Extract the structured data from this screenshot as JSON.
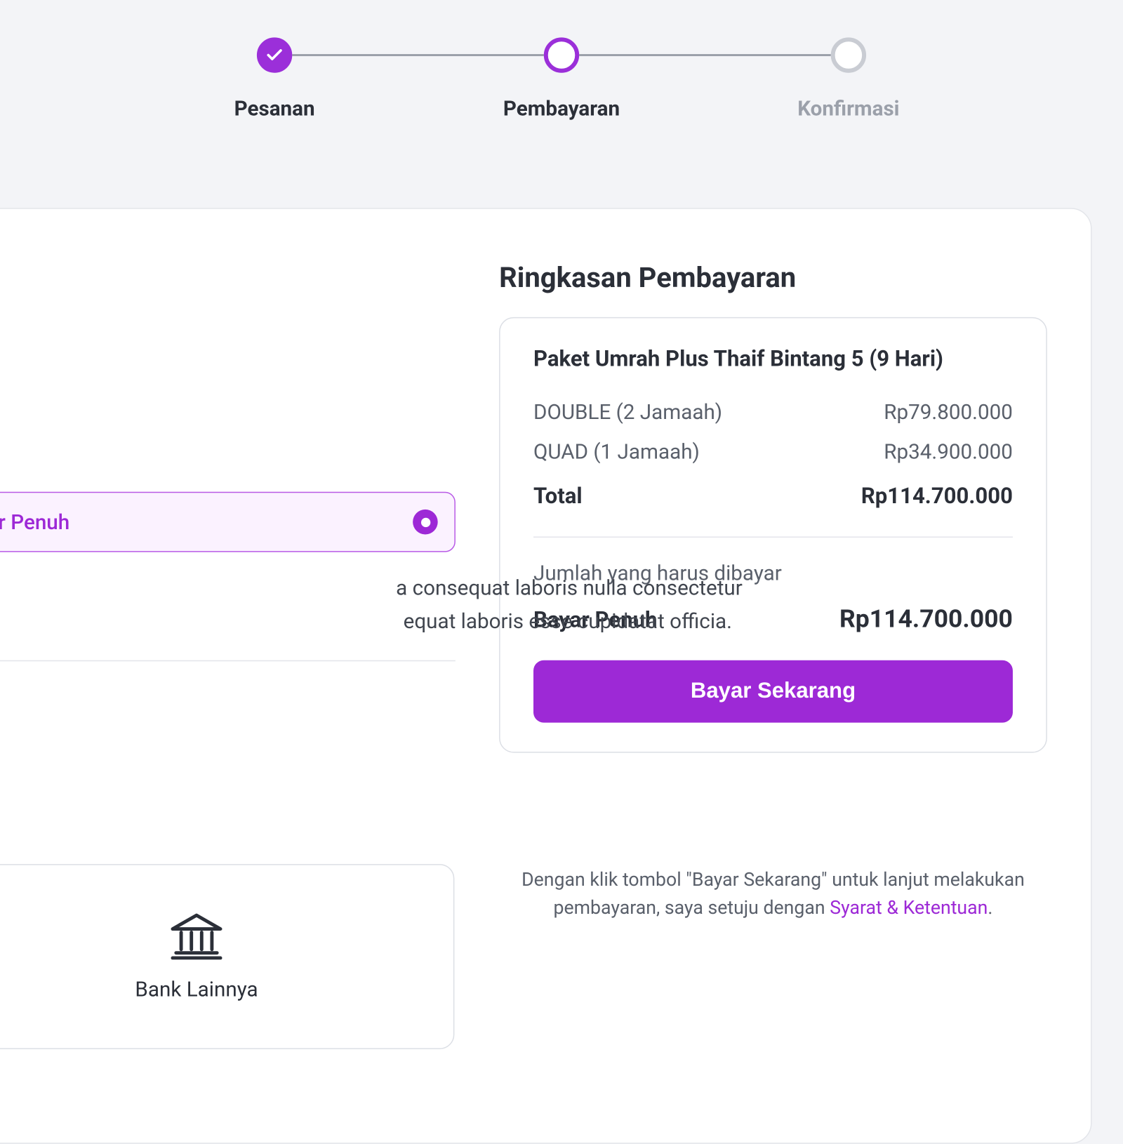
{
  "stepper": {
    "steps": [
      {
        "label": "Pesanan",
        "state": "completed"
      },
      {
        "label": "Pembayaran",
        "state": "active"
      },
      {
        "label": "Konfirmasi",
        "state": "inactive"
      }
    ]
  },
  "left": {
    "radio_label": "ar Penuh",
    "desc_line1": "a consequat laboris nulla consectetur",
    "desc_line2": "equat laboris esse cupidatat officia.",
    "bank_label": "Bank Lainnya"
  },
  "summary": {
    "title": "Ringkasan Pembayaran",
    "package": "Paket Umrah Plus Thaif Bintang 5 (9 Hari)",
    "lines": [
      {
        "label": "DOUBLE (2 Jamaah)",
        "value": "Rp79.800.000"
      },
      {
        "label": "QUAD (1 Jamaah)",
        "value": "Rp34.900.000"
      }
    ],
    "total_label": "Total",
    "total_value": "Rp114.700.000",
    "due_label": "Jumlah yang harus dibayar",
    "pay_type": "Bayar Penuh",
    "pay_amount": "Rp114.700.000",
    "pay_button": "Bayar Sekarang"
  },
  "agree": {
    "pre": "Dengan klik tombol \"Bayar Sekarang\" untuk lanjut melakukan pembayaran, saya setuju dengan ",
    "link": "Syarat & Ketentuan",
    "post": "."
  }
}
